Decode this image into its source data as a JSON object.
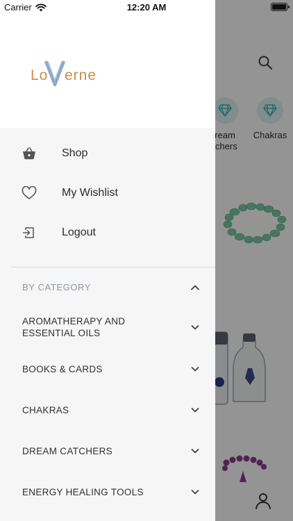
{
  "status_bar": {
    "carrier": "Carrier",
    "time": "12:20 AM"
  },
  "brand": {
    "logo_text": "Laverne",
    "logo_letters_left": "Lo",
    "logo_letters_right": "erne",
    "logo_letter_mark": "V"
  },
  "drawer": {
    "menu": [
      {
        "label": "Shop",
        "icon": "basket-icon"
      },
      {
        "label": "My Wishlist",
        "icon": "heart-icon"
      },
      {
        "label": "Logout",
        "icon": "logout-icon"
      }
    ],
    "section": {
      "label": "BY CATEGORY",
      "expanded": true
    },
    "categories": [
      {
        "label": "AROMATHERAPY AND ESSENTIAL OILS"
      },
      {
        "label": "BOOKS & CARDS"
      },
      {
        "label": "CHAKRAS"
      },
      {
        "label": "DREAM CATCHERS"
      },
      {
        "label": "ENERGY HEALING TOOLS"
      }
    ]
  },
  "background": {
    "categories": [
      {
        "label": "ream\ntchers",
        "icon": "diamond-icon"
      },
      {
        "label": "Chakras",
        "icon": "diamond-icon"
      }
    ]
  },
  "colors": {
    "accent": "#3fb7b0",
    "section_label": "#8c97a7",
    "text": "#2b2b2b",
    "drawer_bg": "#f6f6f6"
  }
}
